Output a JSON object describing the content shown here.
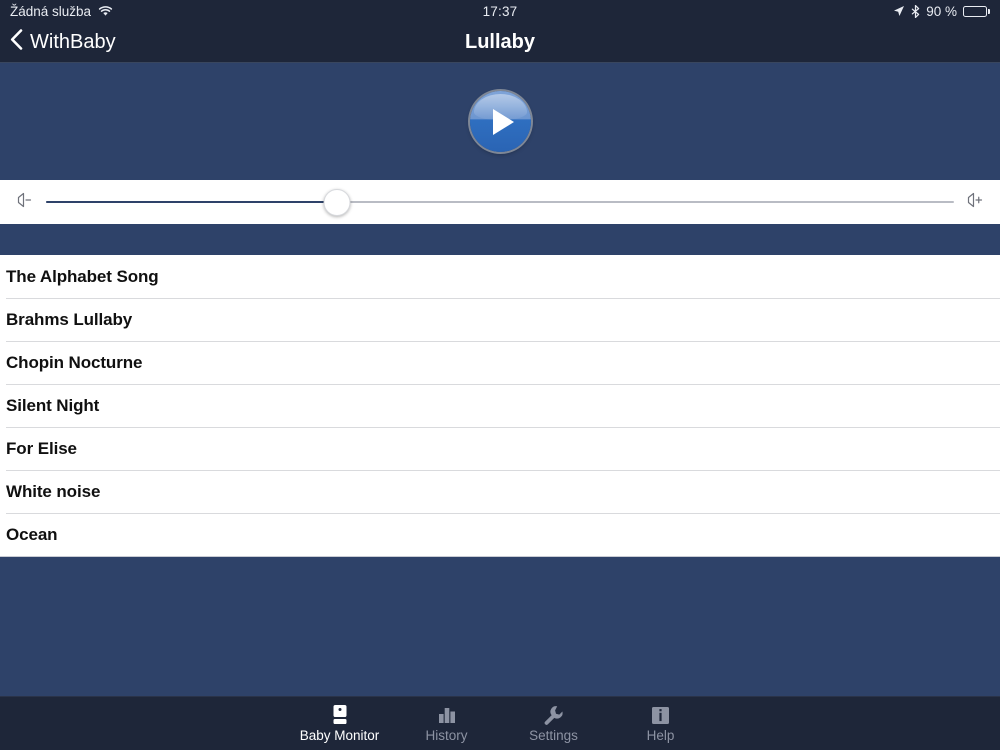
{
  "status_bar": {
    "carrier": "Žádná služba",
    "wifi_icon": "wifi-icon",
    "time": "17:37",
    "location_icon": "location-arrow-icon",
    "bluetooth_icon": "bluetooth-icon",
    "battery_percent": "90 %",
    "battery_level": 90,
    "battery_icon": "battery-icon"
  },
  "nav_bar": {
    "back_icon": "chevron-left-icon",
    "back_label": "WithBaby",
    "title": "Lullaby"
  },
  "player": {
    "play_button_icon": "play-icon",
    "play_button_label": "Play"
  },
  "volume": {
    "min_icon": "speaker-minus-icon",
    "max_icon": "speaker-plus-icon",
    "value_percent": 32
  },
  "songs": [
    {
      "title": "The Alphabet Song"
    },
    {
      "title": "Brahms Lullaby"
    },
    {
      "title": "Chopin Nocturne"
    },
    {
      "title": "Silent Night"
    },
    {
      "title": "For Elise"
    },
    {
      "title": "White noise"
    },
    {
      "title": "Ocean"
    }
  ],
  "tab_bar": {
    "items": [
      {
        "label": "Baby Monitor",
        "icon": "baby-monitor-icon",
        "active": true
      },
      {
        "label": "History",
        "icon": "bar-chart-icon",
        "active": false
      },
      {
        "label": "Settings",
        "icon": "wrench-icon",
        "active": false
      },
      {
        "label": "Help",
        "icon": "info-icon",
        "active": false
      }
    ]
  },
  "colors": {
    "header_navy": "#1e2639",
    "content_navy": "#2e4269",
    "accent_blue": "#2a64b4",
    "tab_inactive": "#8d93a3",
    "tab_active": "#ffffff"
  }
}
